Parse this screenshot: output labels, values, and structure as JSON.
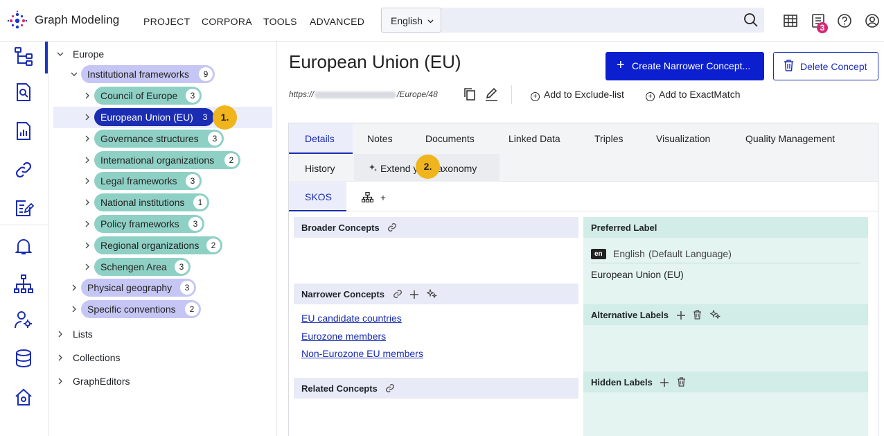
{
  "app": {
    "brand": "Graph Modeling",
    "nav": [
      "PROJECT",
      "CORPORA",
      "TOOLS",
      "ADVANCED"
    ],
    "language_selector": "English",
    "notification_count": "3",
    "icons": [
      "grid-icon",
      "notifications-icon",
      "help-icon",
      "account-icon"
    ]
  },
  "rail": {
    "items": [
      "taxonomy-tree-icon",
      "search-document-icon",
      "analytics-icon",
      "link-icon",
      "edit-checklist-icon",
      "bell-icon",
      "hierarchy-icon",
      "user-settings-icon",
      "database-icon",
      "home-settings-icon"
    ]
  },
  "tree": {
    "root": "Europe",
    "group": {
      "label": "Institutional frameworks",
      "count": "9"
    },
    "children": [
      {
        "label": "Council of Europe",
        "count": "3"
      },
      {
        "label": "European Union (EU)",
        "count": "3"
      },
      {
        "label": "Governance structures",
        "count": "3"
      },
      {
        "label": "International organizations",
        "count": "2"
      },
      {
        "label": "Legal frameworks",
        "count": "3"
      },
      {
        "label": "National institutions",
        "count": "1"
      },
      {
        "label": "Policy frameworks",
        "count": "3"
      },
      {
        "label": "Regional organizations",
        "count": "2"
      },
      {
        "label": "Schengen Area",
        "count": "3"
      }
    ],
    "siblings": [
      {
        "label": "Physical geography",
        "count": "3"
      },
      {
        "label": "Specific conventions",
        "count": "2"
      }
    ],
    "other_roots": [
      "Lists",
      "Collections",
      "GraphEditors"
    ],
    "markers": [
      "1.",
      "2."
    ]
  },
  "concept": {
    "title": "European Union (EU)",
    "create_button": "Create Narrower Concept...",
    "delete_button": "Delete Concept",
    "uri_prefix": "https://",
    "uri_suffix": "/Europe/48",
    "add_exclude": "Add to Exclude-list",
    "add_exactmatch": "Add to ExactMatch"
  },
  "tabs": {
    "row1": [
      "Details",
      "Notes",
      "Documents",
      "Linked Data",
      "Triples",
      "Visualization",
      "Quality Management"
    ],
    "row2": [
      "History",
      "Extend your taxonomy"
    ],
    "row3_skos": "SKOS",
    "row3_add": "+"
  },
  "left": {
    "broader": "Broader Concepts",
    "narrower": "Narrower Concepts",
    "narrower_items": [
      "EU candidate countries",
      "Eurozone members",
      "Non-Eurozone EU members"
    ],
    "related": "Related Concepts"
  },
  "right": {
    "preferred": "Preferred Label",
    "lang_code": "en",
    "lang_label": "English",
    "lang_note": "(Default Language)",
    "pref_value": "European Union (EU)",
    "alternative": "Alternative Labels",
    "hidden": "Hidden Labels"
  }
}
